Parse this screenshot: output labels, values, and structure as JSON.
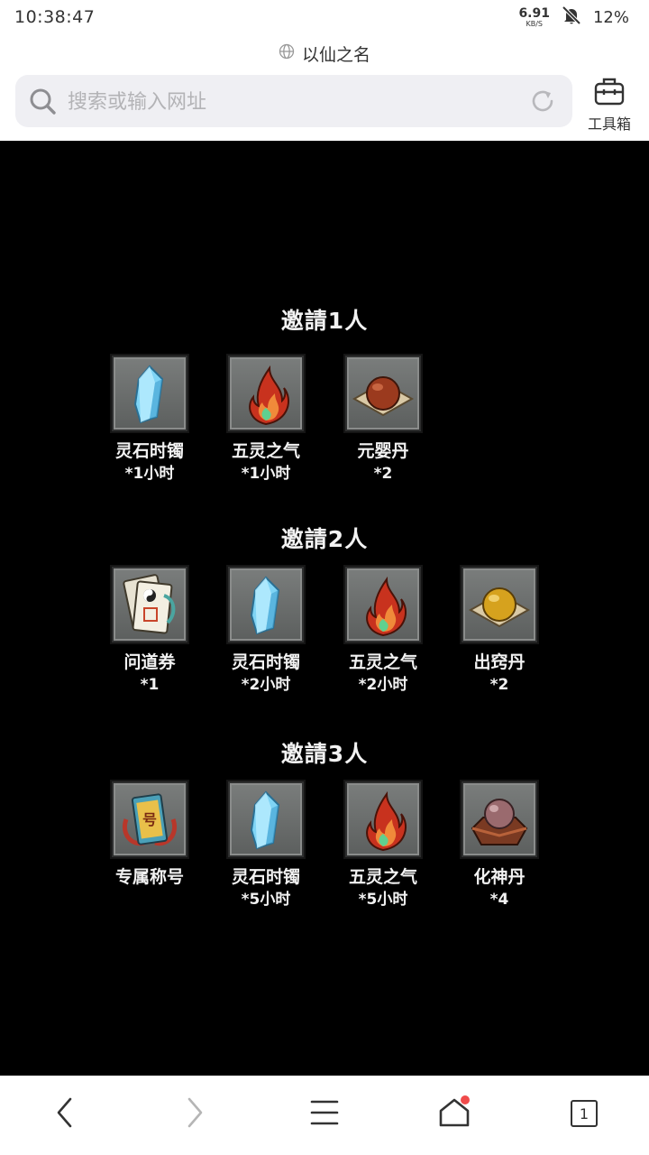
{
  "status_bar": {
    "time": "10:38:47",
    "net_speed": "6.91",
    "net_unit": "KB/S",
    "battery": "12%"
  },
  "page": {
    "title": "以仙之名"
  },
  "address_bar": {
    "placeholder": "搜索或输入网址"
  },
  "toolbox": {
    "label": "工具箱"
  },
  "tiers": [
    {
      "title": "邀請1人",
      "rewards": [
        {
          "name": "灵石时镯",
          "qty": "*1小时",
          "icon": "crystal-icon"
        },
        {
          "name": "五灵之气",
          "qty": "*1小时",
          "icon": "flame-icon"
        },
        {
          "name": "元婴丹",
          "qty": "*2",
          "icon": "red-pill-icon"
        }
      ]
    },
    {
      "title": "邀請2人",
      "rewards": [
        {
          "name": "问道券",
          "qty": "*1",
          "icon": "taoist-ticket-icon"
        },
        {
          "name": "灵石时镯",
          "qty": "*2小时",
          "icon": "crystal-icon"
        },
        {
          "name": "五灵之气",
          "qty": "*2小时",
          "icon": "flame-icon"
        },
        {
          "name": "出窍丹",
          "qty": "*2",
          "icon": "gold-pill-icon"
        }
      ]
    },
    {
      "title": "邀請3人",
      "rewards": [
        {
          "name": "专属称号",
          "qty": "",
          "icon": "title-badge-icon"
        },
        {
          "name": "灵石时镯",
          "qty": "*5小时",
          "icon": "crystal-icon"
        },
        {
          "name": "五灵之气",
          "qty": "*5小时",
          "icon": "flame-icon"
        },
        {
          "name": "化神丹",
          "qty": "*4",
          "icon": "purple-pill-icon"
        }
      ]
    }
  ],
  "bottom_nav": {
    "tab_count": "1"
  },
  "colors": {
    "content_bg": "#000000",
    "notification_dot": "#f04b4b"
  }
}
